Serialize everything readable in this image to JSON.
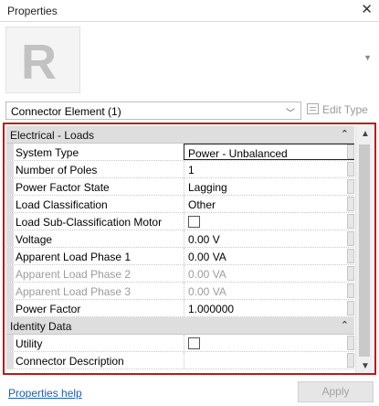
{
  "window": {
    "title": "Properties",
    "close_glyph": "✕"
  },
  "preview": {
    "icon": "revit-r-logo",
    "letter": "R"
  },
  "type_selector": {
    "value": "Connector Element (1)",
    "edit_type_label": "Edit Type"
  },
  "groups": [
    {
      "name": "Electrical - Loads",
      "toggle": "⌃⌃",
      "rows": [
        {
          "label": "System Type",
          "value": "Power - Unbalanced",
          "kind": "text",
          "selected": true
        },
        {
          "label": "Number of Poles",
          "value": "1",
          "kind": "text"
        },
        {
          "label": "Power Factor State",
          "value": "Lagging",
          "kind": "text"
        },
        {
          "label": "Load Classification",
          "value": "Other",
          "kind": "text"
        },
        {
          "label": "Load Sub-Classification Motor",
          "value": "",
          "kind": "checkbox",
          "checked": false
        },
        {
          "label": "Voltage",
          "value": "0.00 V",
          "kind": "text"
        },
        {
          "label": "Apparent Load Phase 1",
          "value": "0.00 VA",
          "kind": "text"
        },
        {
          "label": "Apparent Load Phase 2",
          "value": "0.00 VA",
          "kind": "text",
          "disabled": true
        },
        {
          "label": "Apparent Load Phase 3",
          "value": "0.00 VA",
          "kind": "text",
          "disabled": true
        },
        {
          "label": "Power Factor",
          "value": "1.000000",
          "kind": "text"
        }
      ]
    },
    {
      "name": "Identity Data",
      "toggle": "⌃⌃",
      "rows": [
        {
          "label": "Utility",
          "value": "",
          "kind": "checkbox",
          "checked": false
        },
        {
          "label": "Connector Description",
          "value": "",
          "kind": "text"
        }
      ]
    }
  ],
  "footer": {
    "help_link": "Properties help",
    "apply_label": "Apply"
  },
  "colors": {
    "highlight_border": "#b71c1c",
    "link": "#1a5fb4",
    "group_bg": "#dedede"
  }
}
